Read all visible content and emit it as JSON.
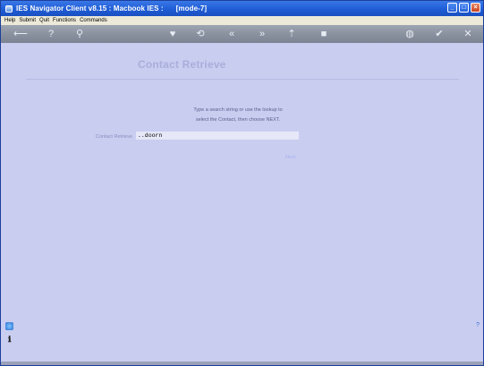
{
  "window": {
    "title": "IES Navigator Client v8.15 : Macbook IES :      [mode-7]"
  },
  "menu": [
    "Help",
    "Submit",
    "Quit",
    "Functions",
    "Commands"
  ],
  "toolbar": {
    "icons": [
      "back-arrow-icon",
      "help-icon",
      "search-icon",
      "heart-icon",
      "refresh-icon",
      "rewind-icon",
      "fast-forward-icon",
      "upload-icon",
      "stop-icon",
      "globe-icon",
      "check-icon",
      "close-icon"
    ],
    "glyphs": [
      "⟵",
      "?",
      "⚲",
      "♥",
      "⟲",
      "«",
      "»",
      "⇡",
      "■",
      "◍",
      "✔",
      "✕"
    ]
  },
  "main": {
    "title": "Contact Retrieve",
    "instruction_line1": "Type a search string or use the lookup to",
    "instruction_line2": "select the Contact, then choose NEXT.",
    "field_label": "Contact Retrieve",
    "field_value": "..doorn",
    "next_label": "Next"
  },
  "colors": {
    "background": "#c9cdf0",
    "titlebar": "#1f5dd6",
    "title_text": "#a9aedb"
  }
}
